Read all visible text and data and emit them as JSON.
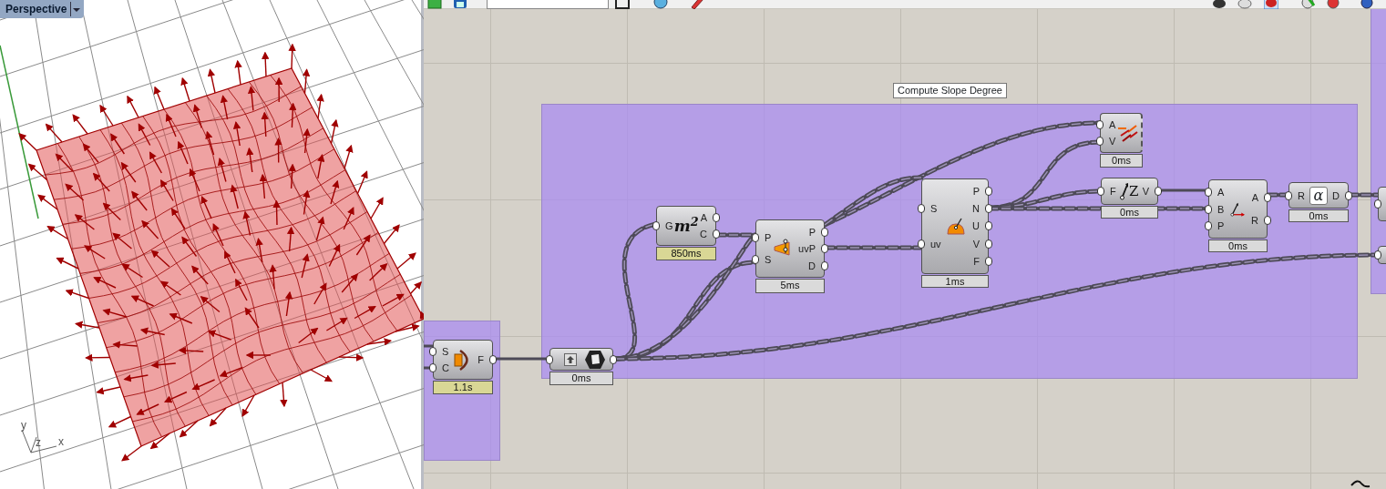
{
  "viewport": {
    "title": "Perspective",
    "axis_labels": [
      "y",
      "z",
      "x"
    ]
  },
  "canvas": {
    "group_title": "Compute Slope Degree",
    "components": [
      {
        "kind": "arc",
        "inputs": [
          "S",
          "C"
        ],
        "outputs": [
          "F"
        ],
        "time": "1.1s",
        "slow": true
      },
      {
        "kind": "export",
        "time": "0ms",
        "slow": false
      },
      {
        "kind": "area",
        "icon_text": "m$^{2}$",
        "inputs": [
          "G"
        ],
        "outputs": [
          "A",
          "C"
        ],
        "time": "850ms",
        "slow": true
      },
      {
        "kind": "closest",
        "inputs": [
          "P",
          "S"
        ],
        "outputs": [
          "P",
          "uvP",
          "D"
        ],
        "time": "5ms",
        "slow": false
      },
      {
        "kind": "evaluate",
        "inputs": [
          "S",
          "uv"
        ],
        "outputs": [
          "P",
          "N",
          "U",
          "V",
          "F"
        ],
        "time": "1ms",
        "slow": false
      },
      {
        "kind": "vectors",
        "inputs": [
          "A",
          "V"
        ],
        "time": "0ms",
        "slow": false
      },
      {
        "kind": "unitz",
        "icon_text": "Z",
        "inputs": [
          "F"
        ],
        "outputs": [
          "V"
        ],
        "time": "0ms",
        "slow": false
      },
      {
        "kind": "angle",
        "inputs": [
          "A",
          "B",
          "P"
        ],
        "outputs": [
          "A",
          "R"
        ],
        "time": "0ms",
        "slow": false
      },
      {
        "kind": "degrees",
        "icon_text": "α",
        "inputs": [
          "R"
        ],
        "outputs": [
          "D"
        ],
        "time": "0ms",
        "slow": false
      },
      {
        "kind": "clipped"
      },
      {
        "kind": "clipped"
      }
    ]
  }
}
